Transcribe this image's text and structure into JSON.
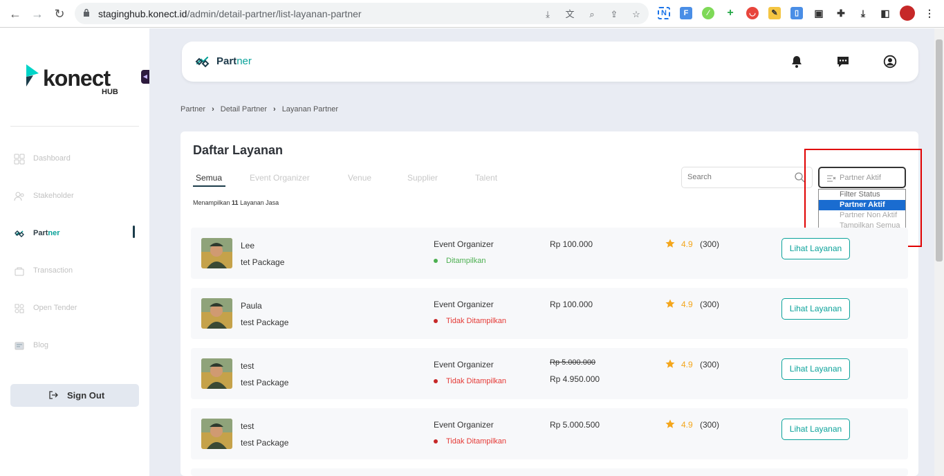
{
  "browser": {
    "url_host": "staginghub.konect.id",
    "url_path": "/admin/detail-partner/list-layanan-partner"
  },
  "sidebar": {
    "logo_word": "konect",
    "logo_sub": "HUB",
    "items": [
      {
        "label": "Dashboard",
        "icon": "dashboard-icon"
      },
      {
        "label": "Stakeholder",
        "icon": "stakeholder-icon"
      },
      {
        "label_a": "Part",
        "label_b": "ner",
        "icon": "partner-icon",
        "active": true
      },
      {
        "label": "Transaction",
        "icon": "transaction-icon"
      },
      {
        "label": "Open Tender",
        "icon": "open-tender-icon"
      },
      {
        "label": "Blog",
        "icon": "blog-icon"
      }
    ],
    "signout_label": "Sign Out"
  },
  "topbar": {
    "title_a": "Part",
    "title_b": "ner"
  },
  "breadcrumb": [
    "Partner",
    "Detail Partner",
    "Layanan Partner"
  ],
  "content": {
    "title": "Daftar Layanan",
    "tabs": [
      "Semua",
      "Event Organizer",
      "Venue",
      "Supplier",
      "Talent"
    ],
    "count_prefix": "Menampilkan",
    "count_value": "11",
    "count_suffix": "Layanan Jasa",
    "search_placeholder": "Search",
    "filter_value": "Partner Aktif",
    "filter_options": [
      "Filter Status",
      "Partner Aktif",
      "Partner Non Aktif",
      "Tampilkan Semua"
    ]
  },
  "rows": [
    {
      "name": "Lee",
      "package": "tet Package",
      "category": "Event Organizer",
      "status": "Ditampilkan",
      "price": "Rp 100.000",
      "rating": "4.9",
      "reviews": "(300)",
      "button": "Lihat Layanan"
    },
    {
      "name": "Paula",
      "package": "test Package",
      "category": "Event Organizer",
      "status": "Tidak Ditampilkan",
      "price": "Rp 100.000",
      "rating": "4.9",
      "reviews": "(300)",
      "button": "Lihat Layanan"
    },
    {
      "name": "test",
      "package": "test Package",
      "category": "Event Organizer",
      "status": "Tidak Ditampilkan",
      "old_price": "Rp 5.000.000",
      "price": "Rp 4.950.000",
      "rating": "4.9",
      "reviews": "(300)",
      "button": "Lihat Layanan"
    },
    {
      "name": "test",
      "package": "test Package",
      "category": "Event Organizer",
      "status": "Tidak Ditampilkan",
      "price": "Rp 5.000.500",
      "rating": "4.9",
      "reviews": "(300)",
      "button": "Lihat Layanan"
    }
  ],
  "colors": {
    "accent": "#0aa29a",
    "navy": "#1b3c4a",
    "active_status": "#4caf50",
    "inactive_status": "#e53935",
    "rating": "#f4a61c",
    "highlight_box": "#e00000"
  }
}
